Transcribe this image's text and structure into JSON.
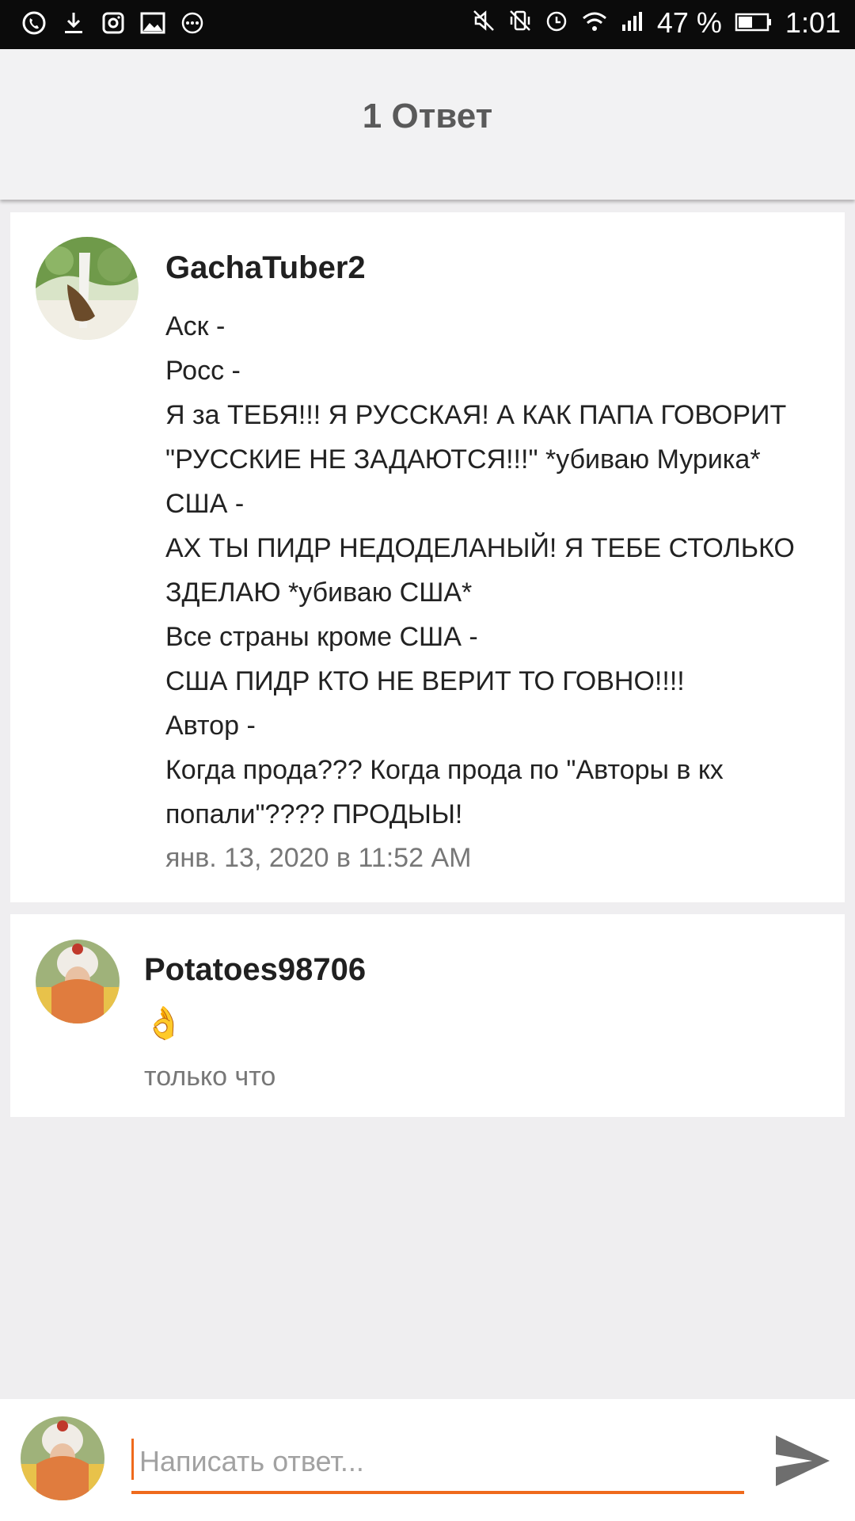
{
  "status_bar": {
    "left_icons": [
      "viber-icon",
      "download-icon",
      "instagram-icon",
      "gallery-icon",
      "more-icon"
    ],
    "right_icons": [
      "mute-icon",
      "vibrate-off-icon",
      "alarm-icon",
      "wifi-icon",
      "signal-icon"
    ],
    "battery": "47 %",
    "time": "1:01"
  },
  "header": {
    "title": "1 Ответ"
  },
  "comments": [
    {
      "username": "GachaTuber2",
      "lines": [
        "Аск -",
        "Росс -",
        "Я за ТЕБЯ!!! Я РУССКАЯ! А КАК ПАПА ГОВОРИТ",
        "\"РУССКИЕ НЕ ЗАДАЮТСЯ!!!\" *убиваю Мурика*",
        "США -",
        "АХ ТЫ ПИДР НЕДОДЕЛАНЫЙ! Я ТЕБЕ СТОЛЬКО",
        "ЗДЕЛАЮ *убиваю США*",
        "Все страны кроме США -",
        "США ПИДР КТО НЕ ВЕРИТ ТО ГОВНО!!!!",
        "Автор -",
        "Когда прода??? Когда прода по \"Авторы в кх",
        "попали\"???? ПРОДЫЫ!"
      ],
      "timestamp": "янв. 13, 2020 в 11:52 AM"
    },
    {
      "username": "Potatoes98706",
      "text": "👌",
      "timestamp": "только что"
    }
  ],
  "reply": {
    "placeholder": "Написать ответ...",
    "value": ""
  },
  "colors": {
    "accent": "#ef6a1c",
    "background": "#efeef0",
    "header": "#f2f2f3"
  }
}
